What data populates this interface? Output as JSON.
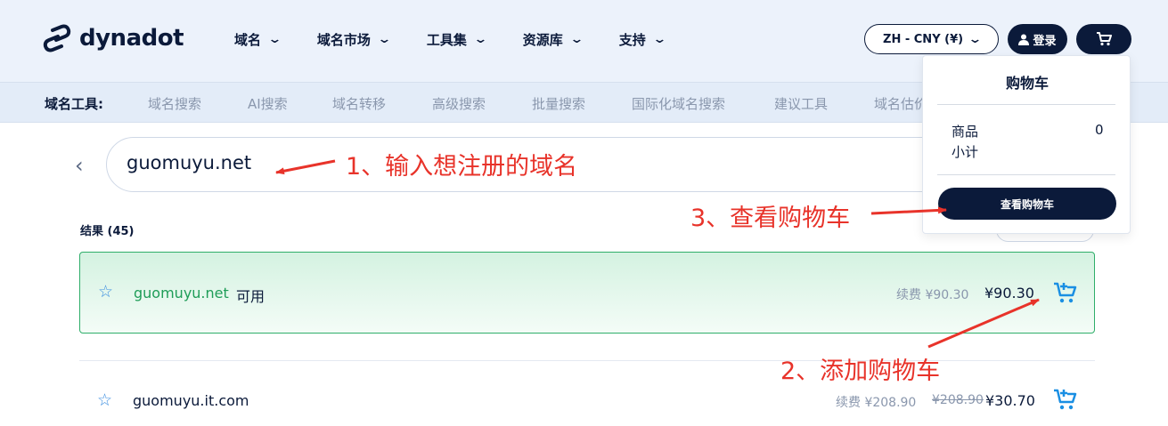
{
  "header": {
    "logo_text": "dynadot",
    "nav": [
      {
        "label": "域名"
      },
      {
        "label": "域名市场"
      },
      {
        "label": "工具集"
      },
      {
        "label": "资源库"
      },
      {
        "label": "支持"
      }
    ],
    "language_currency": "ZH - CNY (¥)",
    "login_label": "登录"
  },
  "toolbar": {
    "label": "域名工具:",
    "tools": [
      "域名搜索",
      "AI搜索",
      "域名转移",
      "高级搜索",
      "批量搜索",
      "国际化域名搜索",
      "建议工具",
      "域名估价"
    ]
  },
  "search": {
    "value": "guomuyu.net"
  },
  "results": {
    "label": "结果 (45)",
    "rows": [
      {
        "domain": "guomuyu.net",
        "status": "可用",
        "renewal": "续费 ¥90.30",
        "price": "¥90.30"
      },
      {
        "domain": "guomuyu.it.com",
        "renewal": "续费 ¥208.90",
        "old_price": "¥208.90",
        "price": "¥30.70"
      }
    ]
  },
  "cart": {
    "title": "购物车",
    "items_label": "商品",
    "items_count": "0",
    "subtotal_label": "小计",
    "view_button": "查看购物车"
  },
  "annotations": {
    "step1": "1、输入想注册的域名",
    "step2": "2、添加购物车",
    "step3": "3、查看购物车"
  },
  "colors": {
    "navy": "#0b1a3a",
    "available_green": "#1f9d58",
    "cart_icon_blue": "#1a8fe3",
    "annotation_red": "#e8332a"
  }
}
